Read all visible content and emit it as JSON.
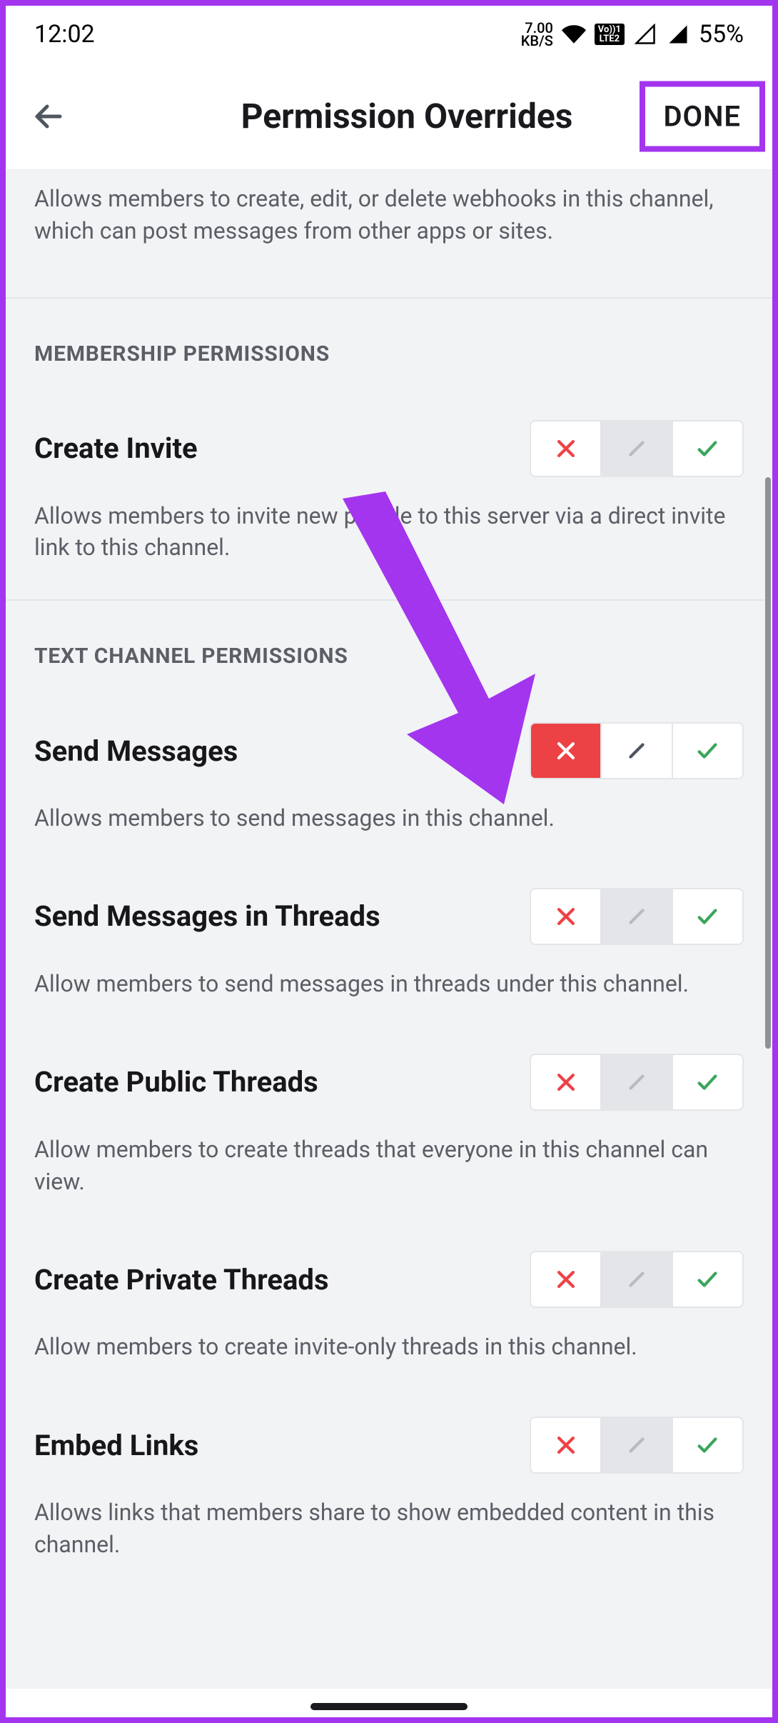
{
  "statusbar": {
    "time": "12:02",
    "kbs_top": "7.00",
    "kbs_bottom": "KB/S",
    "battery": "55%"
  },
  "appbar": {
    "title": "Permission Overrides",
    "done": "DONE"
  },
  "intro": "Allows members to create, edit, or delete webhooks in this channel, which can post messages from other apps or sites.",
  "sections": {
    "membership": "MEMBERSHIP PERMISSIONS",
    "textchannel": "TEXT CHANNEL PERMISSIONS"
  },
  "perms": {
    "create_invite": {
      "title": "Create Invite",
      "desc": "Allows members to invite new people to this server via a direct invite link to this channel."
    },
    "send_messages": {
      "title": "Send Messages",
      "desc": "Allows members to send messages in this channel."
    },
    "send_messages_threads": {
      "title": "Send Messages in Threads",
      "desc": "Allow members to send messages in threads under this channel."
    },
    "create_public_threads": {
      "title": "Create Public Threads",
      "desc": "Allow members to create threads that everyone in this channel can view."
    },
    "create_private_threads": {
      "title": "Create Private Threads",
      "desc": "Allow members to create invite-only threads in this channel."
    },
    "embed_links": {
      "title": "Embed Links",
      "desc": "Allows links that members share to show embedded content in this channel."
    }
  }
}
